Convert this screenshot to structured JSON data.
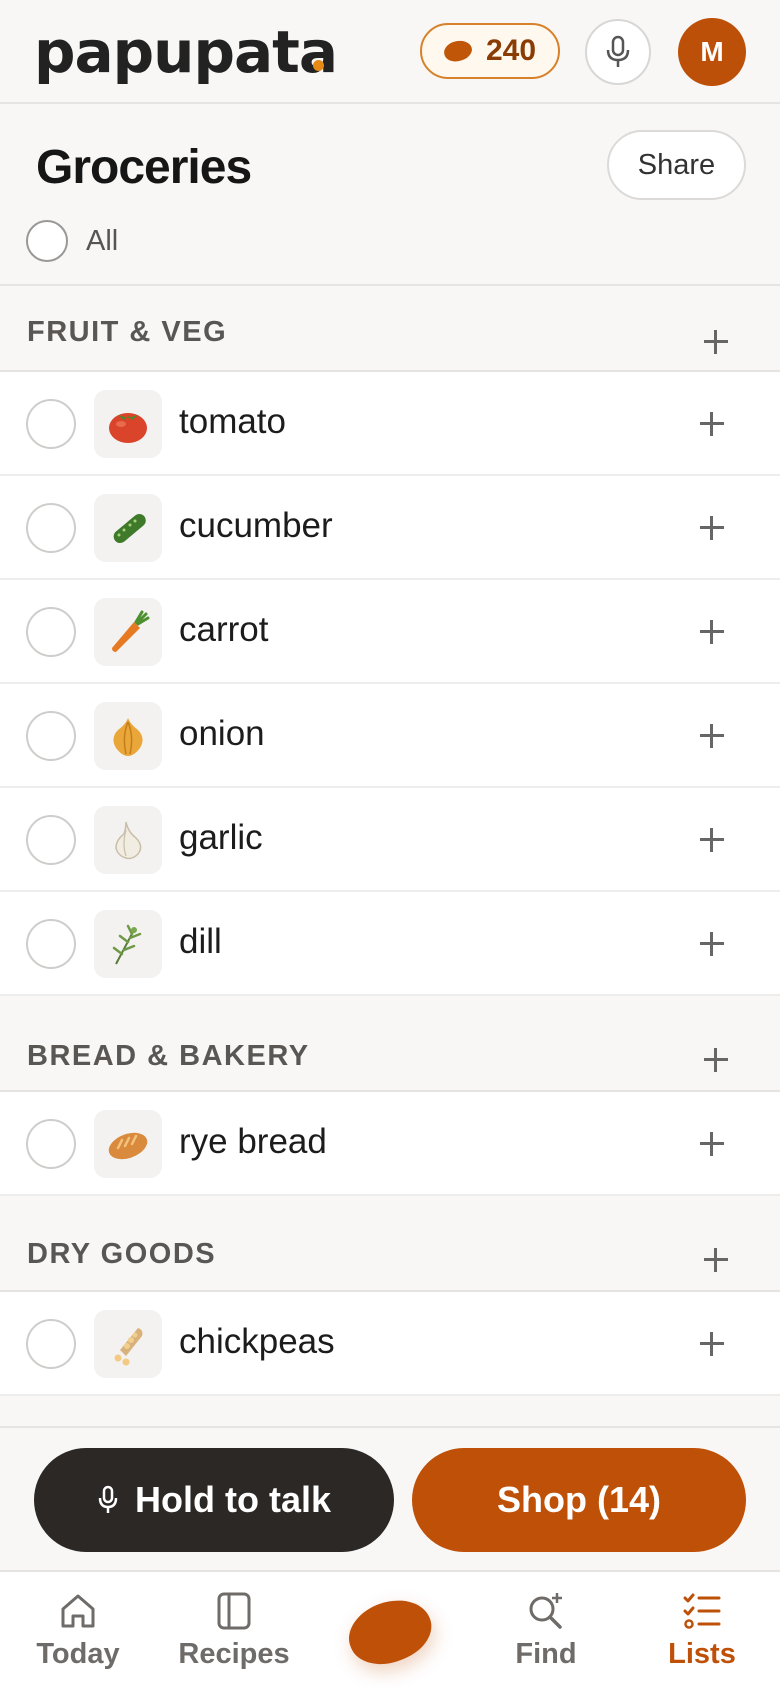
{
  "header": {
    "logo_text": "papupata",
    "coins": "240",
    "avatar_initial": "M"
  },
  "page": {
    "title": "Groceries",
    "share_label": "Share",
    "all_label": "All"
  },
  "sections": [
    {
      "title": "FRUIT & VEG",
      "items": [
        {
          "name": "tomato",
          "icon": "tomato-icon"
        },
        {
          "name": "cucumber",
          "icon": "cucumber-icon"
        },
        {
          "name": "carrot",
          "icon": "carrot-icon"
        },
        {
          "name": "onion",
          "icon": "onion-icon"
        },
        {
          "name": "garlic",
          "icon": "garlic-icon"
        },
        {
          "name": "dill",
          "icon": "dill-icon"
        }
      ]
    },
    {
      "title": "BREAD & BAKERY",
      "items": [
        {
          "name": "rye bread",
          "icon": "bread-icon"
        }
      ]
    },
    {
      "title": "DRY GOODS",
      "items": [
        {
          "name": "chickpeas",
          "icon": "chickpeas-icon"
        }
      ]
    }
  ],
  "actions": {
    "talk_label": "Hold to talk",
    "shop_label": "Shop (14)"
  },
  "tabs": [
    {
      "label": "Today",
      "icon": "home-icon",
      "active": false
    },
    {
      "label": "Recipes",
      "icon": "book-icon",
      "active": false
    },
    {
      "label": "",
      "icon": "bean-icon",
      "active": false
    },
    {
      "label": "Find",
      "icon": "search-plus-icon",
      "active": false
    },
    {
      "label": "Lists",
      "icon": "checklist-icon",
      "active": true
    }
  ],
  "colors": {
    "accent": "#bf5008",
    "dark_button": "#2b2826",
    "coin_border": "#d7812a"
  }
}
